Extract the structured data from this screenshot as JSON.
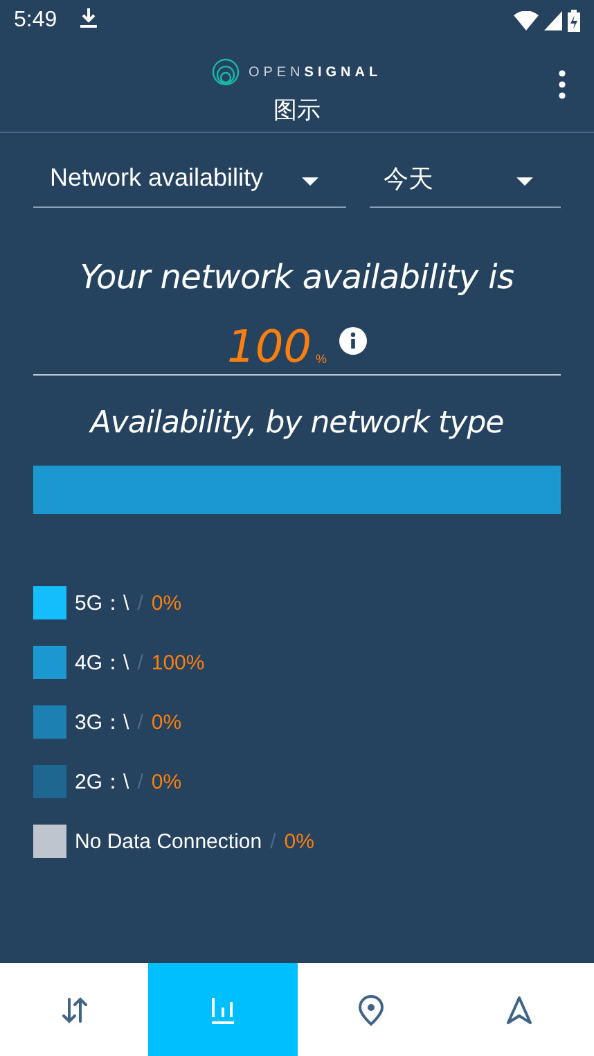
{
  "status_bar": {
    "time": "5:49"
  },
  "header": {
    "logo": {
      "light": "OPEN",
      "bold": "SIGNAL"
    },
    "title": "图示"
  },
  "filters": [
    {
      "label": "Network availability"
    },
    {
      "label": "今天"
    }
  ],
  "headline": "Your network availability is",
  "availability": {
    "value": "100",
    "unit": "%"
  },
  "subtitle": "Availability, by network type",
  "network_types": [
    {
      "label": "5G：\\",
      "separator": "/",
      "value": "0%",
      "color": "#14bdfb",
      "level": 0
    },
    {
      "label": "4G：\\",
      "separator": "/",
      "value": "100%",
      "color": "#1c98d0",
      "level": 1
    },
    {
      "label": "3G：\\",
      "separator": "/",
      "value": "0%",
      "color": "#1c80b2",
      "level": 0
    },
    {
      "label": "2G：\\",
      "separator": "/",
      "value": "0%",
      "color": "#1e6791",
      "level": 0
    },
    {
      "label": "No Data Connection",
      "separator": "/",
      "value": "0%",
      "color": "#bfc5cf",
      "level": 0
    }
  ],
  "bottom_nav": [
    {
      "kind": "transfer",
      "selected": false
    },
    {
      "kind": "chart",
      "selected": true
    },
    {
      "kind": "pin",
      "selected": false
    },
    {
      "kind": "navigate",
      "selected": false
    }
  ]
}
